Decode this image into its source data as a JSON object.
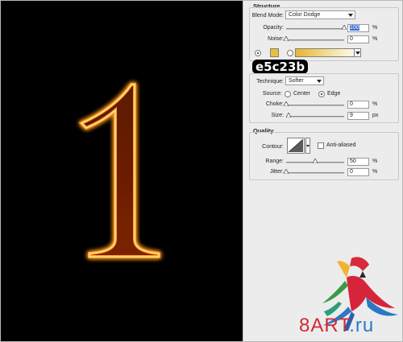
{
  "canvas": {
    "digit": "1",
    "glow_color": "#ff8a1c",
    "background": "#000000"
  },
  "structure": {
    "title": "Structure",
    "blend_mode_label": "Blend Mode:",
    "blend_mode_value": "Color Dodge",
    "opacity_label": "Opacity:",
    "opacity_value": "100",
    "opacity_level": 1.0,
    "noise_label": "Noise:",
    "noise_value": "0",
    "noise_level": 0.0,
    "percent": "%",
    "color_swatch": "#e5c23b",
    "hex_label": "e5c23b"
  },
  "elements": {
    "technique_label": "Technique:",
    "technique_value": "Softer",
    "source_label": "Source:",
    "source_center": "Center",
    "source_edge": "Edge",
    "choke_label": "Choke:",
    "choke_value": "0",
    "choke_level": 0.0,
    "size_label": "Size:",
    "size_value": "9",
    "size_level": 0.04,
    "percent": "%",
    "px": "px"
  },
  "quality": {
    "title": "Quality",
    "contour_label": "Contour:",
    "anti_aliased_label": "Anti-aliased",
    "range_label": "Range:",
    "range_value": "50",
    "range_level": 0.5,
    "jitter_label": "Jitter:",
    "jitter_value": "0",
    "jitter_level": 0.0,
    "percent": "%"
  },
  "watermark": {
    "text_a": "8ART",
    "text_b": ".ru"
  },
  "icons": [
    "dropdown-arrow-icon",
    "slider-thumb-icon",
    "radio-icon",
    "contour-curve-icon",
    "parrot-logo-icon"
  ]
}
